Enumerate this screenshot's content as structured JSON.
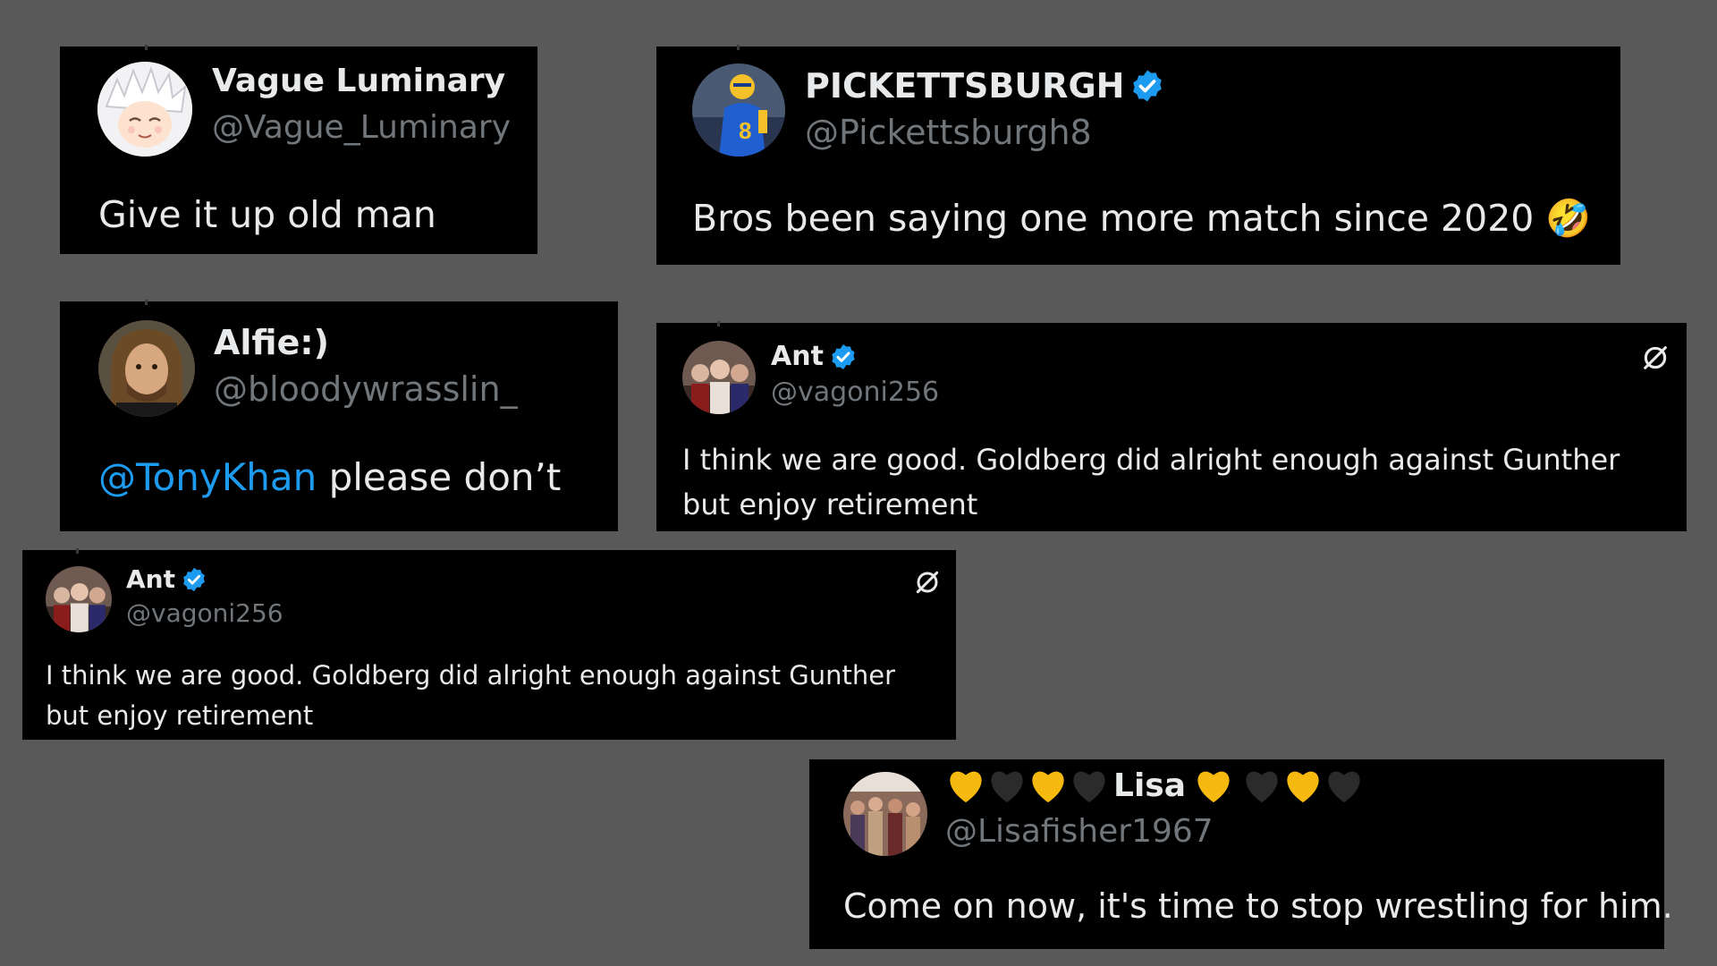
{
  "colors": {
    "background": "#595959",
    "card": "#000000",
    "text": "#e7e9ea",
    "handle": "#71767b",
    "mention": "#1d9bf0",
    "verified": "#1d9bf0",
    "heart_yellow": "#f5b90f",
    "heart_black": "#2b2b2b"
  },
  "tweets": [
    {
      "name": "Vague Luminary",
      "handle": "@Vague_Luminary",
      "text": "Give it up old man",
      "verified": false,
      "avatar_icon": "anime-avatar"
    },
    {
      "name": "PICKETTSBURGH",
      "handle": "@Pickettsburgh8",
      "text": "Bros been saying one more match since 2020 🤣",
      "verified": true,
      "avatar_icon": "football-player-avatar"
    },
    {
      "name": "Alfie:)",
      "handle": "@bloodywrasslin_",
      "mention": "@TonyKhan",
      "text": " please don’t",
      "verified": false,
      "avatar_icon": "man-photo-avatar"
    },
    {
      "name": "Ant",
      "handle": "@vagoni256",
      "text": "I think we are good. Goldberg did alright enough against Gunther but enjoy retirement",
      "verified": true,
      "avatar_icon": "group-photo-avatar"
    },
    {
      "name": "Ant",
      "handle": "@vagoni256",
      "text": "I think we are good. Goldberg did alright enough against Gunther but enjoy retirement",
      "verified": true,
      "avatar_icon": "group-photo-avatar"
    },
    {
      "name": "Lisa",
      "handle": "@Lisafisher1967",
      "text": "Come on now, it's time to stop wrestling for him.",
      "verified": false,
      "hearts_before": [
        "yellow",
        "black",
        "yellow",
        "black"
      ],
      "hearts_after": [
        "yellow",
        "black",
        "yellow",
        "black"
      ],
      "avatar_icon": "wrestlers-photo-avatar"
    }
  ]
}
